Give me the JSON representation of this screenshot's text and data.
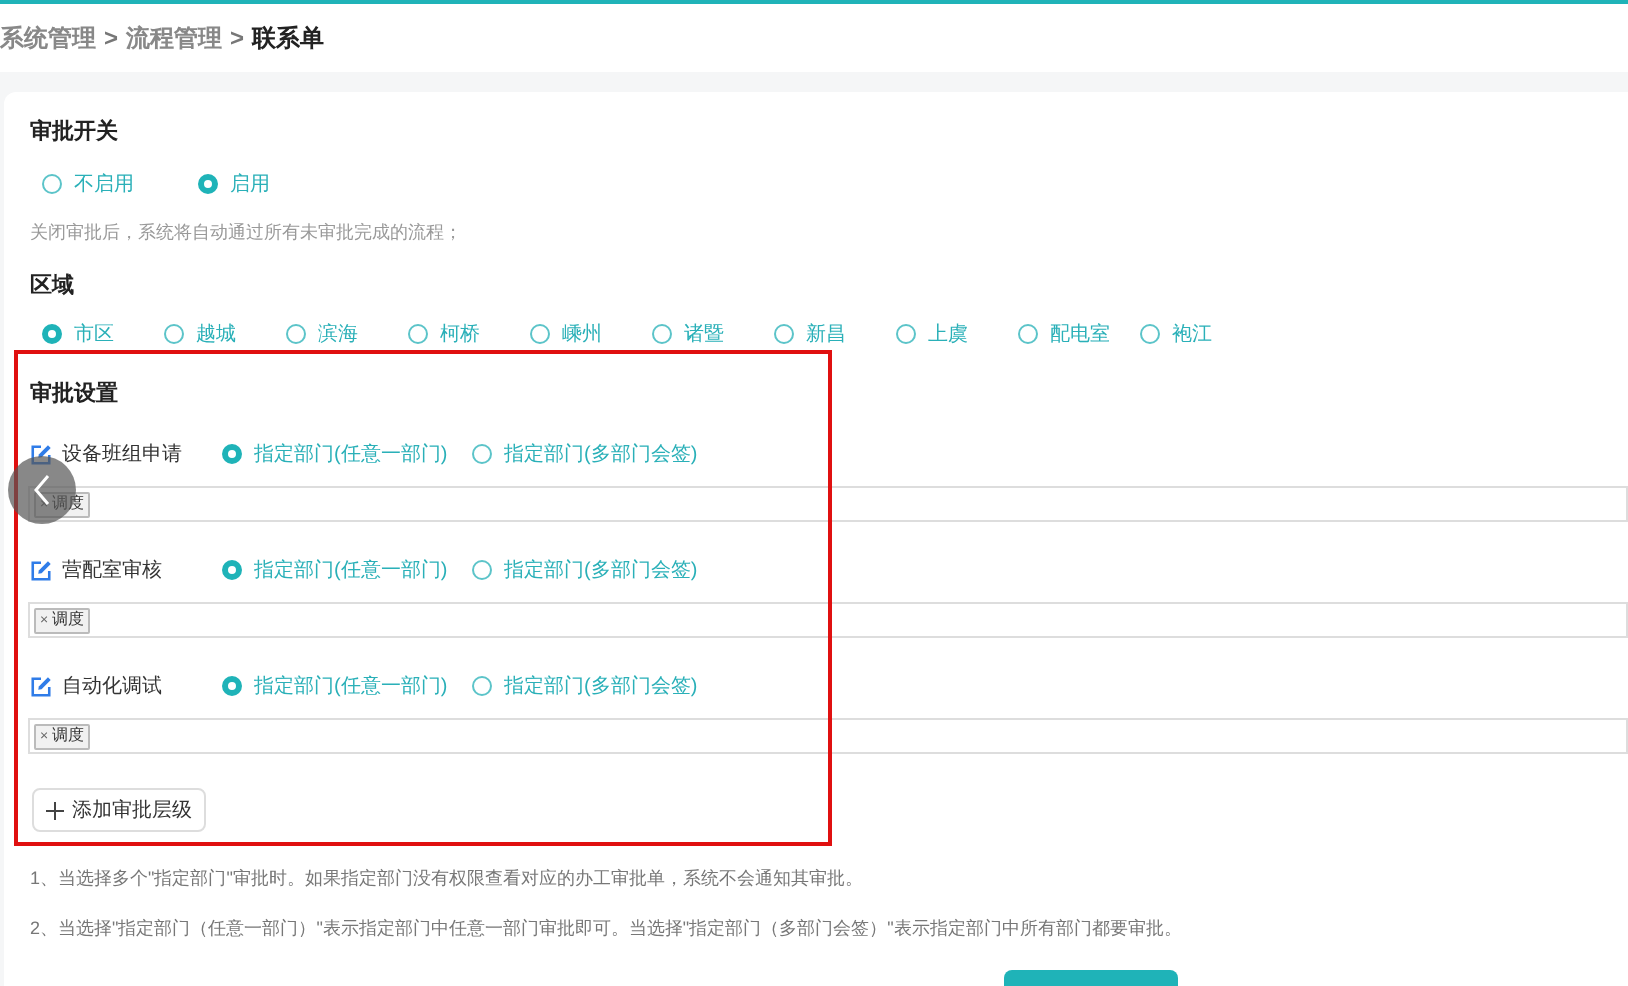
{
  "breadcrumb": [
    {
      "label": "系统管理",
      "current": false
    },
    {
      "label": "流程管理",
      "current": false
    },
    {
      "label": "联系单",
      "current": true
    }
  ],
  "breadcrumb_separator": ">",
  "approval_switch": {
    "title": "审批开关",
    "options": [
      {
        "label": "不启用",
        "selected": false
      },
      {
        "label": "启用",
        "selected": true
      }
    ],
    "hint": "关闭审批后，系统将自动通过所有未审批完成的流程；"
  },
  "region": {
    "title": "区域",
    "options": [
      {
        "label": "市区",
        "selected": true
      },
      {
        "label": "越城",
        "selected": false
      },
      {
        "label": "滨海",
        "selected": false
      },
      {
        "label": "柯桥",
        "selected": false
      },
      {
        "label": "嵊州",
        "selected": false
      },
      {
        "label": "诸暨",
        "selected": false
      },
      {
        "label": "新昌",
        "selected": false
      },
      {
        "label": "上虞",
        "selected": false
      },
      {
        "label": "配电室",
        "selected": false
      },
      {
        "label": "袍江",
        "selected": false
      }
    ]
  },
  "approval_settings": {
    "title": "审批设置",
    "levels": [
      {
        "name": "设备班组申请",
        "options": [
          {
            "label": "指定部门(任意一部门)",
            "selected": true
          },
          {
            "label": "指定部门(多部门会签)",
            "selected": false
          }
        ],
        "tags": [
          {
            "remove": "×",
            "label": "调度"
          }
        ]
      },
      {
        "name": "营配室审核",
        "options": [
          {
            "label": "指定部门(任意一部门)",
            "selected": true
          },
          {
            "label": "指定部门(多部门会签)",
            "selected": false
          }
        ],
        "tags": [
          {
            "remove": "×",
            "label": "调度"
          }
        ]
      },
      {
        "name": "自动化调试",
        "options": [
          {
            "label": "指定部门(任意一部门)",
            "selected": true
          },
          {
            "label": "指定部门(多部门会签)",
            "selected": false
          }
        ],
        "tags": [
          {
            "remove": "×",
            "label": "调度"
          }
        ]
      }
    ],
    "add_button": "添加审批层级"
  },
  "notes": [
    "1、当选择多个\"指定部门\"审批时。如果指定部门没有权限查看对应的办工审批单，系统不会通知其审批。",
    "2、当选择\"指定部门（任意一部门）\"表示指定部门中任意一部门审批即可。当选择\"指定部门（多部门会签）\"表示指定部门中所有部门都要审批。"
  ]
}
